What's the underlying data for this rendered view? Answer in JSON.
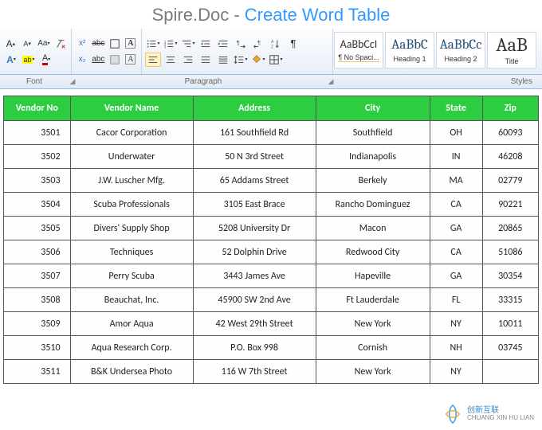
{
  "title": {
    "gray": "Spire.Doc - ",
    "blue": "Create Word Table"
  },
  "ribbon": {
    "font_label": "Font",
    "paragraph_label": "Paragraph",
    "styles_label": "Styles",
    "grow_font": "A",
    "shrink_font": "A",
    "change_case": "Aa",
    "superscript": "x²",
    "highlight_ab": "ab",
    "font_color": "A",
    "font_a": "A",
    "styles": [
      {
        "preview": "AaBbCcI",
        "label": "¶ No Spaci...",
        "class": "normal"
      },
      {
        "preview": "AaBbC",
        "label": "Heading 1",
        "class": ""
      },
      {
        "preview": "AaBbCc",
        "label": "Heading 2",
        "class": ""
      },
      {
        "preview": "AaB",
        "label": "Title",
        "class": "title"
      }
    ]
  },
  "table": {
    "headers": [
      "Vendor No",
      "Vendor Name",
      "Address",
      "City",
      "State",
      "Zip"
    ],
    "rows": [
      [
        "3501",
        "Cacor Corporation",
        "161 Southfield Rd",
        "Southfield",
        "OH",
        "60093"
      ],
      [
        "3502",
        "Underwater",
        "50 N 3rd Street",
        "Indianapolis",
        "IN",
        "46208"
      ],
      [
        "3503",
        "J.W.  Luscher Mfg.",
        "65 Addams Street",
        "Berkely",
        "MA",
        "02779"
      ],
      [
        "3504",
        "Scuba Professionals",
        "3105 East Brace",
        "Rancho Dominguez",
        "CA",
        "90221"
      ],
      [
        "3505",
        "Divers'  Supply Shop",
        "5208 University Dr",
        "Macon",
        "GA",
        "20865"
      ],
      [
        "3506",
        "Techniques",
        "52 Dolphin Drive",
        "Redwood City",
        "CA",
        "51086"
      ],
      [
        "3507",
        "Perry Scuba",
        "3443 James Ave",
        "Hapeville",
        "GA",
        "30354"
      ],
      [
        "3508",
        "Beauchat, Inc.",
        "45900 SW 2nd Ave",
        "Ft Lauderdale",
        "FL",
        "33315"
      ],
      [
        "3509",
        "Amor Aqua",
        "42 West 29th Street",
        "New York",
        "NY",
        "10011"
      ],
      [
        "3510",
        "Aqua Research Corp.",
        "P.O. Box 998",
        "Cornish",
        "NH",
        "03745"
      ],
      [
        "3511",
        "B&K Undersea Photo",
        "116 W 7th Street",
        "New York",
        "NY",
        ""
      ]
    ]
  },
  "watermark": {
    "brand": "创新互联",
    "sub": "CHUANG XIN HU LIAN"
  }
}
